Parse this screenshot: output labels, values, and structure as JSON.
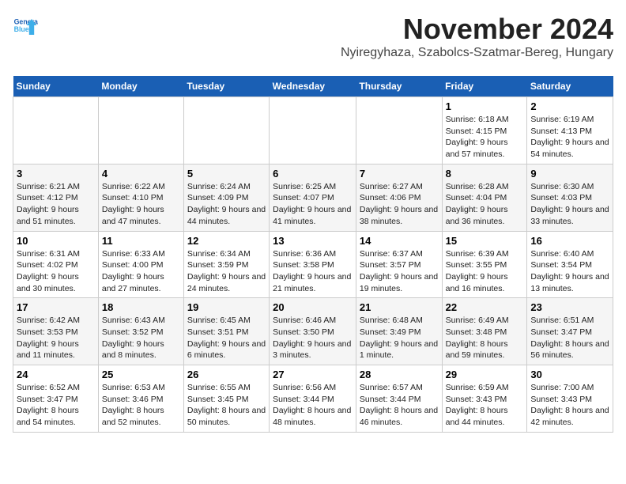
{
  "header": {
    "logo_line1": "General",
    "logo_line2": "Blue",
    "title": "November 2024",
    "subtitle": "Nyiregyhaza, Szabolcs-Szatmar-Bereg, Hungary"
  },
  "columns": [
    "Sunday",
    "Monday",
    "Tuesday",
    "Wednesday",
    "Thursday",
    "Friday",
    "Saturday"
  ],
  "weeks": [
    [
      {
        "day": "",
        "info": ""
      },
      {
        "day": "",
        "info": ""
      },
      {
        "day": "",
        "info": ""
      },
      {
        "day": "",
        "info": ""
      },
      {
        "day": "",
        "info": ""
      },
      {
        "day": "1",
        "info": "Sunrise: 6:18 AM\nSunset: 4:15 PM\nDaylight: 9 hours and 57 minutes."
      },
      {
        "day": "2",
        "info": "Sunrise: 6:19 AM\nSunset: 4:13 PM\nDaylight: 9 hours and 54 minutes."
      }
    ],
    [
      {
        "day": "3",
        "info": "Sunrise: 6:21 AM\nSunset: 4:12 PM\nDaylight: 9 hours and 51 minutes."
      },
      {
        "day": "4",
        "info": "Sunrise: 6:22 AM\nSunset: 4:10 PM\nDaylight: 9 hours and 47 minutes."
      },
      {
        "day": "5",
        "info": "Sunrise: 6:24 AM\nSunset: 4:09 PM\nDaylight: 9 hours and 44 minutes."
      },
      {
        "day": "6",
        "info": "Sunrise: 6:25 AM\nSunset: 4:07 PM\nDaylight: 9 hours and 41 minutes."
      },
      {
        "day": "7",
        "info": "Sunrise: 6:27 AM\nSunset: 4:06 PM\nDaylight: 9 hours and 38 minutes."
      },
      {
        "day": "8",
        "info": "Sunrise: 6:28 AM\nSunset: 4:04 PM\nDaylight: 9 hours and 36 minutes."
      },
      {
        "day": "9",
        "info": "Sunrise: 6:30 AM\nSunset: 4:03 PM\nDaylight: 9 hours and 33 minutes."
      }
    ],
    [
      {
        "day": "10",
        "info": "Sunrise: 6:31 AM\nSunset: 4:02 PM\nDaylight: 9 hours and 30 minutes."
      },
      {
        "day": "11",
        "info": "Sunrise: 6:33 AM\nSunset: 4:00 PM\nDaylight: 9 hours and 27 minutes."
      },
      {
        "day": "12",
        "info": "Sunrise: 6:34 AM\nSunset: 3:59 PM\nDaylight: 9 hours and 24 minutes."
      },
      {
        "day": "13",
        "info": "Sunrise: 6:36 AM\nSunset: 3:58 PM\nDaylight: 9 hours and 21 minutes."
      },
      {
        "day": "14",
        "info": "Sunrise: 6:37 AM\nSunset: 3:57 PM\nDaylight: 9 hours and 19 minutes."
      },
      {
        "day": "15",
        "info": "Sunrise: 6:39 AM\nSunset: 3:55 PM\nDaylight: 9 hours and 16 minutes."
      },
      {
        "day": "16",
        "info": "Sunrise: 6:40 AM\nSunset: 3:54 PM\nDaylight: 9 hours and 13 minutes."
      }
    ],
    [
      {
        "day": "17",
        "info": "Sunrise: 6:42 AM\nSunset: 3:53 PM\nDaylight: 9 hours and 11 minutes."
      },
      {
        "day": "18",
        "info": "Sunrise: 6:43 AM\nSunset: 3:52 PM\nDaylight: 9 hours and 8 minutes."
      },
      {
        "day": "19",
        "info": "Sunrise: 6:45 AM\nSunset: 3:51 PM\nDaylight: 9 hours and 6 minutes."
      },
      {
        "day": "20",
        "info": "Sunrise: 6:46 AM\nSunset: 3:50 PM\nDaylight: 9 hours and 3 minutes."
      },
      {
        "day": "21",
        "info": "Sunrise: 6:48 AM\nSunset: 3:49 PM\nDaylight: 9 hours and 1 minute."
      },
      {
        "day": "22",
        "info": "Sunrise: 6:49 AM\nSunset: 3:48 PM\nDaylight: 8 hours and 59 minutes."
      },
      {
        "day": "23",
        "info": "Sunrise: 6:51 AM\nSunset: 3:47 PM\nDaylight: 8 hours and 56 minutes."
      }
    ],
    [
      {
        "day": "24",
        "info": "Sunrise: 6:52 AM\nSunset: 3:47 PM\nDaylight: 8 hours and 54 minutes."
      },
      {
        "day": "25",
        "info": "Sunrise: 6:53 AM\nSunset: 3:46 PM\nDaylight: 8 hours and 52 minutes."
      },
      {
        "day": "26",
        "info": "Sunrise: 6:55 AM\nSunset: 3:45 PM\nDaylight: 8 hours and 50 minutes."
      },
      {
        "day": "27",
        "info": "Sunrise: 6:56 AM\nSunset: 3:44 PM\nDaylight: 8 hours and 48 minutes."
      },
      {
        "day": "28",
        "info": "Sunrise: 6:57 AM\nSunset: 3:44 PM\nDaylight: 8 hours and 46 minutes."
      },
      {
        "day": "29",
        "info": "Sunrise: 6:59 AM\nSunset: 3:43 PM\nDaylight: 8 hours and 44 minutes."
      },
      {
        "day": "30",
        "info": "Sunrise: 7:00 AM\nSunset: 3:43 PM\nDaylight: 8 hours and 42 minutes."
      }
    ]
  ]
}
